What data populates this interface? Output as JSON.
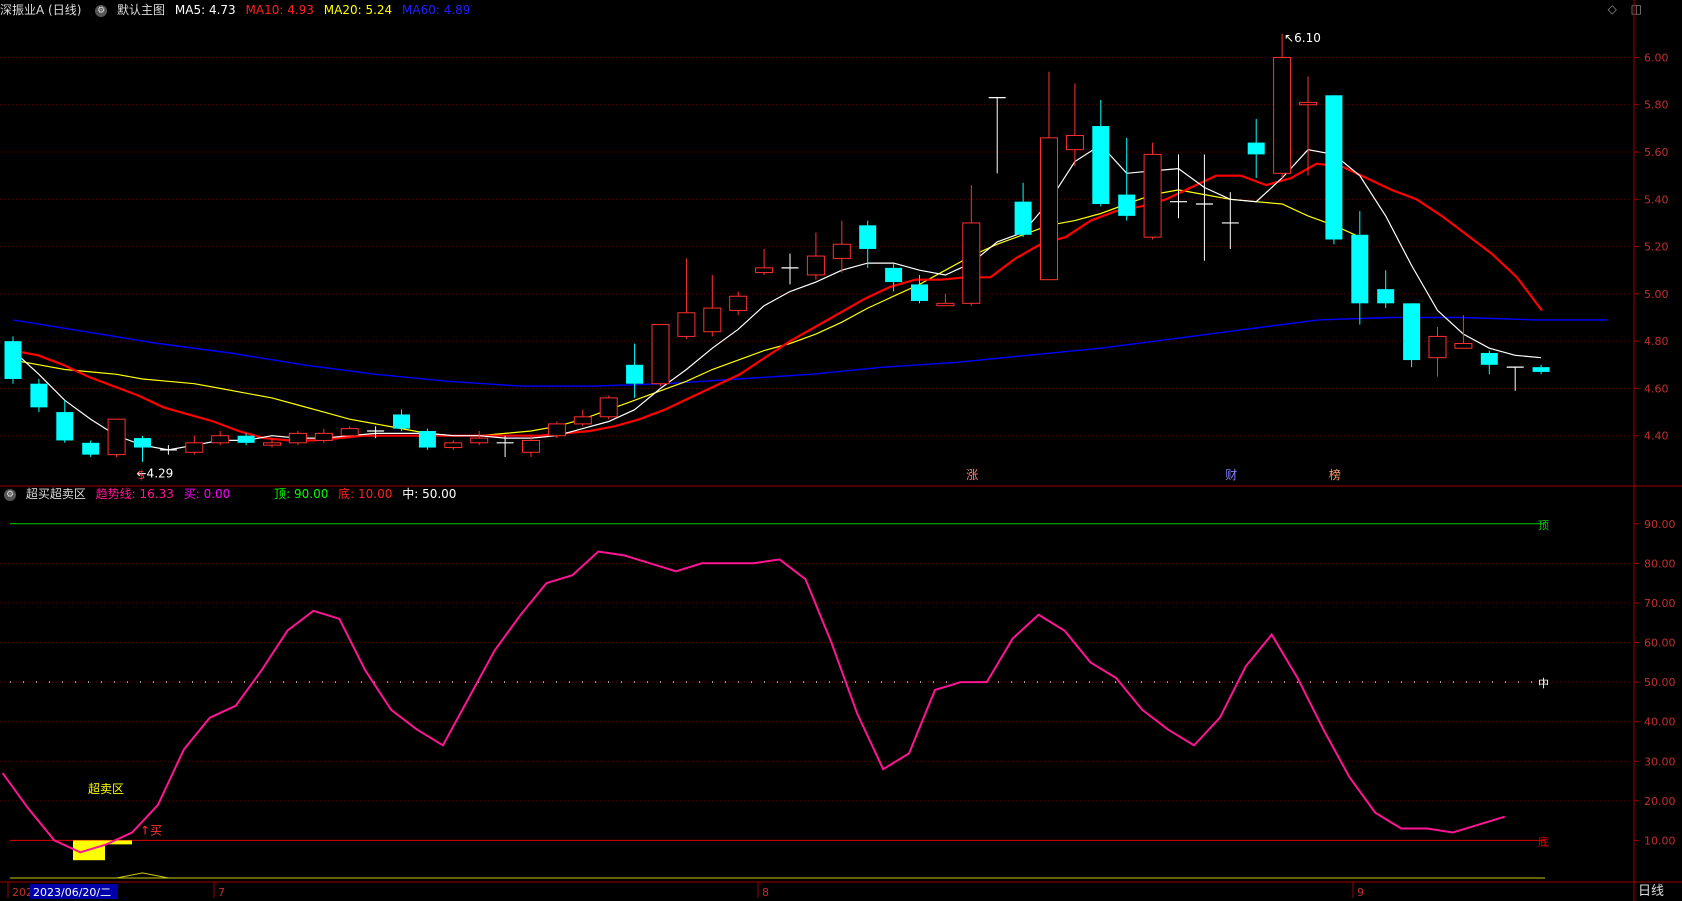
{
  "main_header": {
    "stock": "深振业A (日线)",
    "template": "默认主图",
    "ma5": "MA5: 4.73",
    "ma10": "MA10: 4.93",
    "ma20": "MA20: 5.24",
    "ma60": "MA60: 4.89"
  },
  "sub_header": {
    "indicator": "超买超卖区",
    "trend": "趋势线: 16.33",
    "buy": "买: 0.00",
    "top": "顶: 90.00",
    "bottom": "底: 10.00",
    "mid": "中: 50.00"
  },
  "colors": {
    "up": "#ff3030",
    "down": "#00ffff",
    "ma5": "#ffffff",
    "ma10": "#ff0000",
    "ma20": "#ffff00",
    "ma60": "#0000ff",
    "trend": "#ff1493"
  },
  "icons": [
    "diamond-icon",
    "collapse-icon"
  ],
  "period": "日线",
  "chart_data": [
    {
      "type": "candlestick",
      "title": "深振业A (日线)",
      "ylim": [
        4.2,
        6.15
      ],
      "y_ticks": [
        "6.00",
        "5.80",
        "5.60",
        "5.40",
        "5.20",
        "5.00",
        "4.80",
        "4.60",
        "4.40"
      ],
      "y_tick_values": [
        6.0,
        5.8,
        5.6,
        5.4,
        5.2,
        5.0,
        4.8,
        4.6,
        4.4
      ],
      "x_labels": [
        "202",
        "7",
        "8",
        "9"
      ],
      "cursor_date": "2023/06/20/二",
      "candles": [
        [
          4.8,
          4.64,
          4.82,
          4.62
        ],
        [
          4.62,
          4.52,
          4.64,
          4.5
        ],
        [
          4.5,
          4.38,
          4.55,
          4.37
        ],
        [
          4.37,
          4.32,
          4.38,
          4.31
        ],
        [
          4.32,
          4.47,
          4.47,
          4.31
        ],
        [
          4.39,
          4.35,
          4.4,
          4.29
        ],
        [
          4.34,
          4.34,
          4.36,
          4.32
        ],
        [
          4.33,
          4.37,
          4.4,
          4.32
        ],
        [
          4.37,
          4.4,
          4.42,
          4.36
        ],
        [
          4.4,
          4.37,
          4.41,
          4.36
        ],
        [
          4.36,
          4.37,
          4.39,
          4.35
        ],
        [
          4.37,
          4.41,
          4.42,
          4.36
        ],
        [
          4.38,
          4.41,
          4.43,
          4.37
        ],
        [
          4.4,
          4.43,
          4.44,
          4.39
        ],
        [
          4.42,
          4.42,
          4.44,
          4.39
        ],
        [
          4.49,
          4.43,
          4.51,
          4.42
        ],
        [
          4.42,
          4.35,
          4.43,
          4.34
        ],
        [
          4.35,
          4.37,
          4.38,
          4.34
        ],
        [
          4.37,
          4.39,
          4.42,
          4.36
        ],
        [
          4.37,
          4.37,
          4.4,
          4.31
        ],
        [
          4.33,
          4.38,
          4.4,
          4.31
        ],
        [
          4.4,
          4.45,
          4.46,
          4.39
        ],
        [
          4.45,
          4.48,
          4.51,
          4.44
        ],
        [
          4.48,
          4.56,
          4.57,
          4.47
        ],
        [
          4.7,
          4.62,
          4.79,
          4.56
        ],
        [
          4.62,
          4.87,
          4.87,
          4.61
        ],
        [
          4.82,
          4.92,
          5.15,
          4.81
        ],
        [
          4.84,
          4.94,
          5.08,
          4.82
        ],
        [
          4.93,
          4.99,
          5.01,
          4.91
        ],
        [
          5.09,
          5.11,
          5.19,
          5.08
        ],
        [
          5.11,
          5.11,
          5.17,
          5.04
        ],
        [
          5.08,
          5.16,
          5.26,
          5.06
        ],
        [
          5.15,
          5.21,
          5.31,
          5.09
        ],
        [
          5.29,
          5.19,
          5.31,
          5.11
        ],
        [
          5.11,
          5.05,
          5.13,
          5.01
        ],
        [
          5.04,
          4.97,
          5.08,
          4.96
        ],
        [
          4.95,
          4.96,
          5.0,
          4.95
        ],
        [
          4.96,
          5.3,
          5.46,
          4.95
        ],
        [
          5.83,
          5.83,
          5.83,
          5.51
        ],
        [
          5.39,
          5.25,
          5.47,
          5.24
        ],
        [
          5.06,
          5.66,
          5.94,
          5.06
        ],
        [
          5.61,
          5.67,
          5.89,
          5.54
        ],
        [
          5.71,
          5.38,
          5.82,
          5.37
        ],
        [
          5.42,
          5.33,
          5.66,
          5.31
        ],
        [
          5.24,
          5.59,
          5.64,
          5.23
        ],
        [
          5.39,
          5.39,
          5.59,
          5.32
        ],
        [
          5.38,
          5.38,
          5.59,
          5.14
        ],
        [
          5.3,
          5.3,
          5.43,
          5.19
        ],
        [
          5.64,
          5.59,
          5.74,
          5.49
        ],
        [
          5.51,
          6.0,
          6.1,
          5.49
        ],
        [
          5.8,
          5.81,
          5.92,
          5.5
        ],
        [
          5.84,
          5.23,
          5.84,
          5.21
        ],
        [
          5.25,
          4.96,
          5.35,
          4.87
        ],
        [
          5.02,
          4.96,
          5.1,
          4.94
        ],
        [
          4.96,
          4.72,
          4.96,
          4.69
        ],
        [
          4.73,
          4.82,
          4.86,
          4.65
        ],
        [
          4.77,
          4.79,
          4.91,
          4.77
        ],
        [
          4.75,
          4.7,
          4.76,
          4.66
        ],
        [
          4.69,
          4.69,
          4.69,
          4.59
        ],
        [
          4.69,
          4.67,
          4.7,
          4.66
        ]
      ],
      "ma_points": {
        "MA5": [
          4.76,
          4.66,
          4.55,
          4.47,
          4.4,
          4.36,
          4.34,
          4.36,
          4.38,
          4.38,
          4.4,
          4.39,
          4.39,
          4.4,
          4.41,
          4.41,
          4.41,
          4.4,
          4.4,
          4.39,
          4.39,
          4.4,
          4.43,
          4.46,
          4.51,
          4.6,
          4.68,
          4.77,
          4.85,
          4.95,
          5.01,
          5.05,
          5.1,
          5.13,
          5.13,
          5.1,
          5.08,
          5.13,
          5.22,
          5.26,
          5.39,
          5.56,
          5.63,
          5.51,
          5.52,
          5.53,
          5.45,
          5.4,
          5.39,
          5.49,
          5.61,
          5.59,
          5.5,
          5.33,
          5.12,
          4.93,
          4.83,
          4.77,
          4.74,
          4.73
        ],
        "MA10": [
          4.76,
          4.74,
          4.7,
          4.65,
          4.61,
          4.57,
          4.52,
          4.49,
          4.46,
          4.42,
          4.39,
          4.38,
          4.38,
          4.39,
          4.4,
          4.4,
          4.4,
          4.4,
          4.4,
          4.4,
          4.4,
          4.4,
          4.41,
          4.42,
          4.44,
          4.47,
          4.51,
          4.56,
          4.61,
          4.66,
          4.73,
          4.8,
          4.86,
          4.92,
          4.98,
          5.03,
          5.06,
          5.06,
          5.07,
          5.07,
          5.15,
          5.21,
          5.24,
          5.31,
          5.35,
          5.37,
          5.4,
          5.45,
          5.5,
          5.5,
          5.46,
          5.49,
          5.55,
          5.54,
          5.49,
          5.44,
          5.4,
          5.33,
          5.25,
          5.17,
          5.07,
          4.93
        ],
        "MA20": [
          4.72,
          4.7,
          4.68,
          4.67,
          4.66,
          4.64,
          4.63,
          4.62,
          4.6,
          4.58,
          4.56,
          4.53,
          4.5,
          4.47,
          4.45,
          4.43,
          4.41,
          4.4,
          4.4,
          4.41,
          4.42,
          4.44,
          4.47,
          4.51,
          4.55,
          4.59,
          4.63,
          4.68,
          4.72,
          4.76,
          4.79,
          4.83,
          4.88,
          4.94,
          4.99,
          5.04,
          5.1,
          5.16,
          5.21,
          5.25,
          5.29,
          5.31,
          5.34,
          5.38,
          5.42,
          5.44,
          5.42,
          5.4,
          5.39,
          5.38,
          5.33,
          5.29,
          5.24
        ],
        "MA60": [
          4.89,
          4.84,
          4.79,
          4.75,
          4.7,
          4.66,
          4.63,
          4.61,
          4.61,
          4.62,
          4.64,
          4.66,
          4.69,
          4.71,
          4.74,
          4.77,
          4.81,
          4.85,
          4.89,
          4.9,
          4.9,
          4.89,
          4.89
        ]
      },
      "annotations": [
        {
          "label": "6.10",
          "x_index": 49,
          "value": 6.1
        },
        {
          "label": "4.29",
          "x_index": 5,
          "value": 4.29
        }
      ],
      "event_markers": [
        {
          "label": "$",
          "x_index": 5
        },
        {
          "label": "涨",
          "x_index": 37
        },
        {
          "label": "财",
          "x_index": 47
        },
        {
          "label": "榜",
          "x_index": 51
        }
      ]
    },
    {
      "type": "line",
      "title": "超买超卖区",
      "ylim": [
        0,
        96
      ],
      "y_ticks": [
        "90.00",
        "80.00",
        "70.00",
        "60.00",
        "50.00",
        "40.00",
        "30.00",
        "20.00",
        "10.00"
      ],
      "y_tick_values": [
        90,
        80,
        70,
        60,
        50,
        40,
        30,
        20,
        10
      ],
      "series": [
        {
          "name": "趋势线",
          "values": [
            27,
            18,
            10,
            7,
            9,
            12,
            19,
            33,
            41,
            44,
            53,
            63,
            68,
            66,
            53,
            43,
            38,
            34,
            46,
            58,
            67,
            75,
            77,
            83,
            82,
            80,
            78,
            80,
            80,
            80,
            81,
            76,
            60,
            42,
            28,
            32,
            48,
            50,
            50,
            61,
            67,
            63,
            55,
            51,
            43,
            38,
            34,
            41,
            54,
            62,
            51,
            38,
            26,
            17,
            13,
            13,
            12,
            14,
            16
          ]
        }
      ],
      "ref_lines": [
        {
          "name": "顶",
          "value": 90
        },
        {
          "name": "中",
          "value": 50
        },
        {
          "name": "底",
          "value": 10
        }
      ],
      "annotations": [
        {
          "label": "超卖区"
        },
        {
          "label": "买"
        }
      ]
    }
  ]
}
